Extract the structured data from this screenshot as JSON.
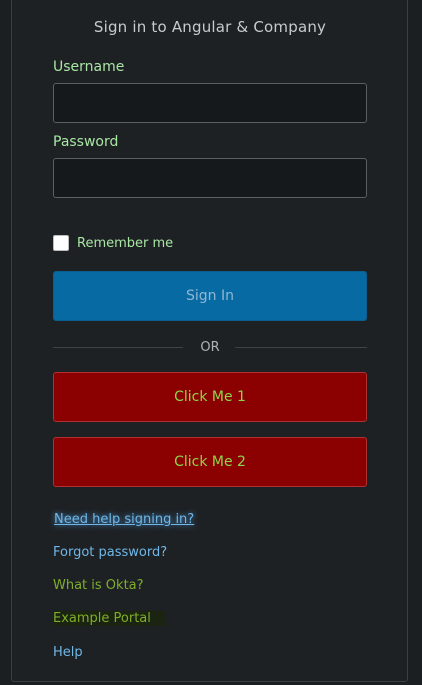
{
  "title": "Sign in to Angular & Company",
  "form": {
    "username_label": "Username",
    "username_value": "",
    "password_label": "Password",
    "password_value": "",
    "remember_label": "Remember me",
    "remember_checked": false,
    "signin_label": "Sign In"
  },
  "divider_text": "OR",
  "buttons": {
    "click1": "Click Me 1",
    "click2": "Click Me 2"
  },
  "links": {
    "need_help": "Need help signing in?",
    "forgot_password": "Forgot password?",
    "what_is_okta": "What is Okta?",
    "example_portal": "Example Portal",
    "help": "Help"
  },
  "colors": {
    "background": "#1c1f21",
    "label_green": "#a8e6a3",
    "signin_blue": "#086aa3",
    "button_red": "#8b0000",
    "link_blue": "#6fb7e8",
    "link_green": "#7fae2a"
  }
}
